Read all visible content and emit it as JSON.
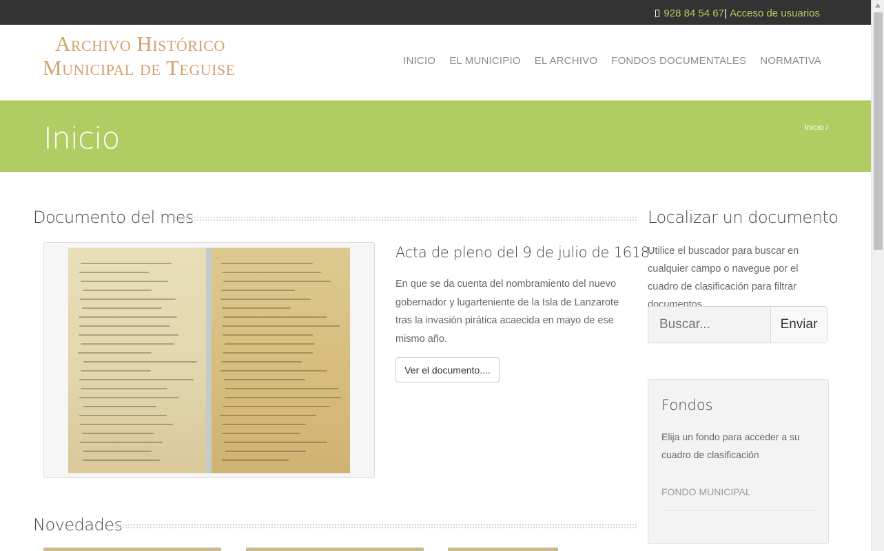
{
  "topbar": {
    "phone": "928 84 54 67",
    "separator": "|",
    "login_link": "Acceso de usuarios"
  },
  "header": {
    "logo_line1": "Archivo Histórico",
    "logo_line2": "Municipal de Teguise",
    "nav": [
      "INICIO",
      "EL MUNICIPIO",
      "EL ARCHIVO",
      "FONDOS DOCUMENTALES",
      "NORMATIVA"
    ]
  },
  "banner": {
    "title": "Inicio",
    "breadcrumb": "Inicio /"
  },
  "main": {
    "section_title": "Documento del mes",
    "doc_title": "Acta de pleno del 9 de julio de 1618",
    "doc_description": "En que se da cuenta del nombramiento del nuevo gobernador y lugarteniente de la Isla de Lanzarote tras la invasión pirática acaecida en mayo de ese mismo año.",
    "doc_button": "Ver el documento....",
    "news_title": "Novedades"
  },
  "sidebar": {
    "title": "Localizar un documento",
    "description": "Utilice el buscador para buscar en cualquier campo o navegue por el cuadro de clasificación para filtrar documentos.",
    "search_placeholder": "Buscar...",
    "search_button": "Enviar",
    "fondos": {
      "title": "Fondos",
      "description": "Elija un fondo para acceder a su cuadro de clasificación",
      "items": [
        "FONDO MUNICIPAL"
      ]
    }
  },
  "colors": {
    "accent_green": "#b0cc63",
    "topbar_bg": "#333333",
    "logo_gold": "#d2a26f"
  },
  "icons": {
    "phone": "phone-icon"
  }
}
